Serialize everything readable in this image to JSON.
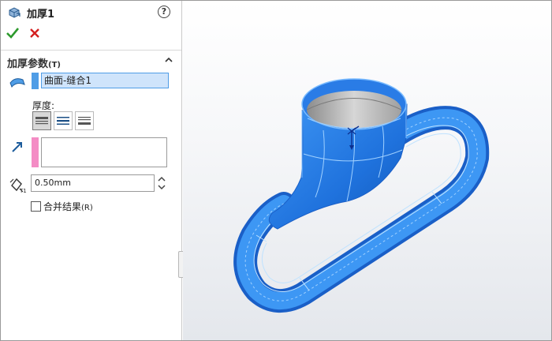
{
  "feature": {
    "title": "加厚1",
    "help_icon": "help-icon"
  },
  "actions": {
    "ok_icon": "checkmark-icon",
    "cancel_icon": "close-icon"
  },
  "section": {
    "title": "加厚参数",
    "shortcut": "(T)"
  },
  "selection": {
    "value": "曲面-缝合1",
    "bar_color": "#4f9de6"
  },
  "thickness": {
    "label": "厚度:",
    "options": [
      "thicken-side1",
      "thicken-both-sides",
      "thicken-side2"
    ],
    "selected_index": 0
  },
  "direction": {
    "bar_color": "#f48cc5"
  },
  "t1": {
    "value": "0.50mm"
  },
  "merge": {
    "label": "合并结果",
    "shortcut": "(R)",
    "checked": false
  },
  "model": {
    "name": "handle-loop-model",
    "color": "#2f86f0"
  }
}
